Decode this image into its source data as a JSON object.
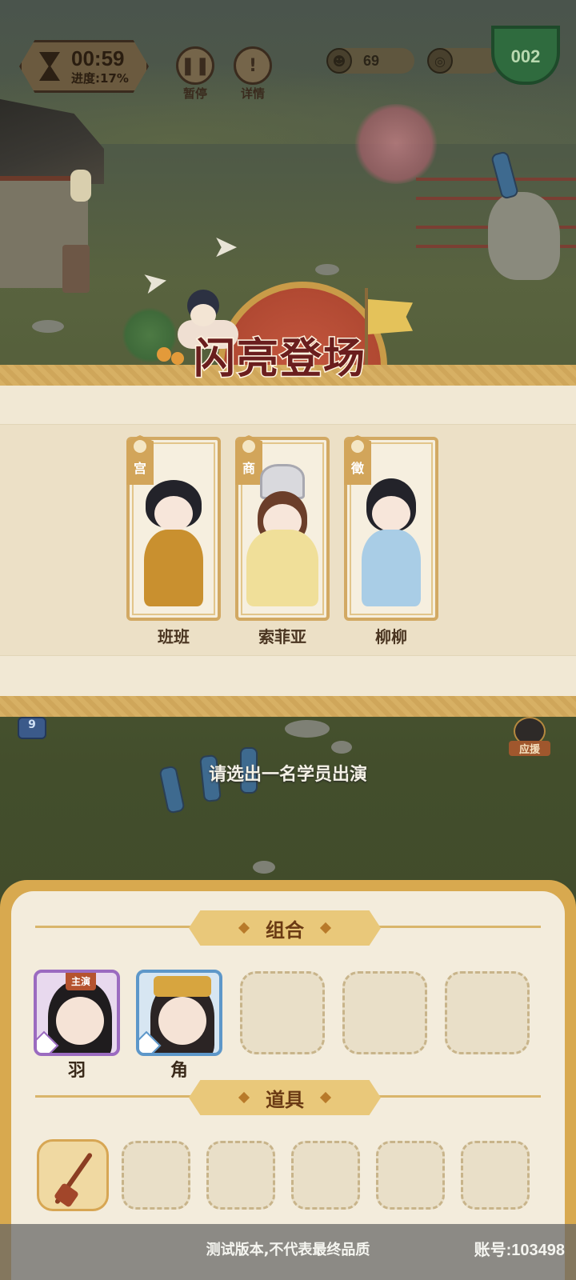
{
  "hud": {
    "time": "00:59",
    "progress": "进度:17%",
    "pause_label": "暂停",
    "details_label": "详情",
    "pause_icon": "pause-icon",
    "details_icon": "exclamation-icon",
    "currency_count": "69",
    "green_button_text": "002",
    "currency_icon": "character-head-icon",
    "coin_icon": "copper-coin-icon"
  },
  "banner": {
    "title": "闪亮登场"
  },
  "characters": [
    {
      "tag": "宫",
      "name": "班班",
      "robe_color": "#c9902f"
    },
    {
      "tag": "商",
      "name": "索菲亚",
      "robe_color": "#f0df99"
    },
    {
      "tag": "徵",
      "name": "柳柳",
      "robe_color": "#a9cde6"
    }
  ],
  "scene": {
    "level": "9",
    "side_avatar_label": "应援",
    "instruction": "请选出一名学员出演"
  },
  "combo": {
    "title": "组合",
    "members": [
      {
        "name": "羽",
        "lead_label": "主演",
        "frame_color": "#9b6bc0"
      },
      {
        "name": "角",
        "frame_color": "#5d97c9"
      }
    ]
  },
  "props": {
    "title": "道具",
    "items": [
      {
        "icon": "erhu-icon"
      }
    ]
  },
  "footer": {
    "notice": "测试版本,不代表最终品质",
    "account": "账号:103498"
  }
}
